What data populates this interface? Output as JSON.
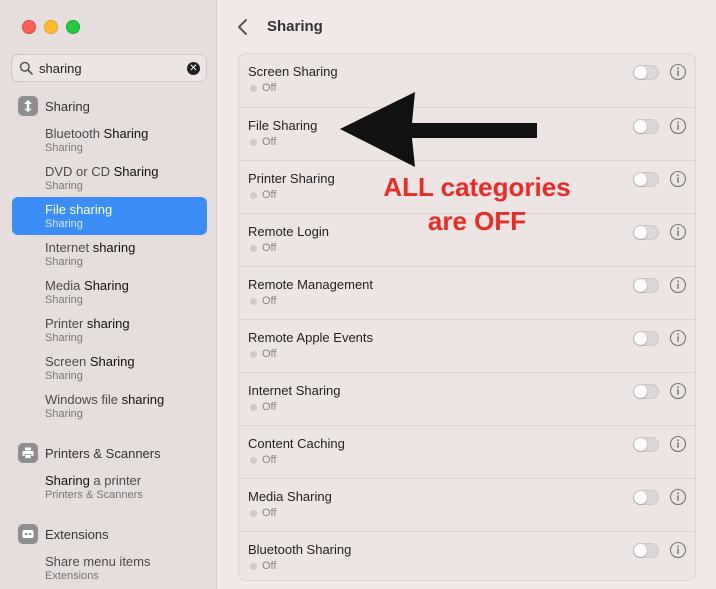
{
  "search": {
    "value": "sharing"
  },
  "sidebar": {
    "sharing_section": {
      "title": "Sharing",
      "items": [
        {
          "pre": "Bluetooth ",
          "match": "Sharing",
          "sub": "Sharing"
        },
        {
          "pre": "DVD or CD ",
          "match": "Sharing",
          "sub": "Sharing"
        },
        {
          "pre": "File ",
          "match": "sharing",
          "sub": "Sharing"
        },
        {
          "pre": "Internet ",
          "match": "sharing",
          "sub": "Sharing"
        },
        {
          "pre": "Media ",
          "match": "Sharing",
          "sub": "Sharing"
        },
        {
          "pre": "Printer ",
          "match": "sharing",
          "sub": "Sharing"
        },
        {
          "pre": "Screen ",
          "match": "Sharing",
          "sub": "Sharing"
        },
        {
          "pre": "Windows file ",
          "match": "sharing",
          "sub": "Sharing"
        }
      ]
    },
    "printers_section": {
      "title": "Printers & Scanners",
      "item": {
        "match": "Sharing",
        "post": " a printer",
        "sub": "Printers & Scanners"
      }
    },
    "extensions_section": {
      "title": "Extensions",
      "item": {
        "text": "Share menu items",
        "sub": "Extensions"
      }
    }
  },
  "main": {
    "title": "Sharing",
    "services": [
      {
        "label": "Screen Sharing",
        "status": "Off"
      },
      {
        "label": "File Sharing",
        "status": "Off"
      },
      {
        "label": "Printer Sharing",
        "status": "Off"
      },
      {
        "label": "Remote Login",
        "status": "Off"
      },
      {
        "label": "Remote Management",
        "status": "Off"
      },
      {
        "label": "Remote Apple Events",
        "status": "Off"
      },
      {
        "label": "Internet Sharing",
        "status": "Off"
      },
      {
        "label": "Content Caching",
        "status": "Off"
      },
      {
        "label": "Media Sharing",
        "status": "Off"
      },
      {
        "label": "Bluetooth Sharing",
        "status": "Off"
      }
    ]
  },
  "annotation": {
    "line1": "ALL categories",
    "line2": "are OFF"
  },
  "colors": {
    "accent": "#3b8ef5",
    "annotation": "#ee2a24"
  }
}
